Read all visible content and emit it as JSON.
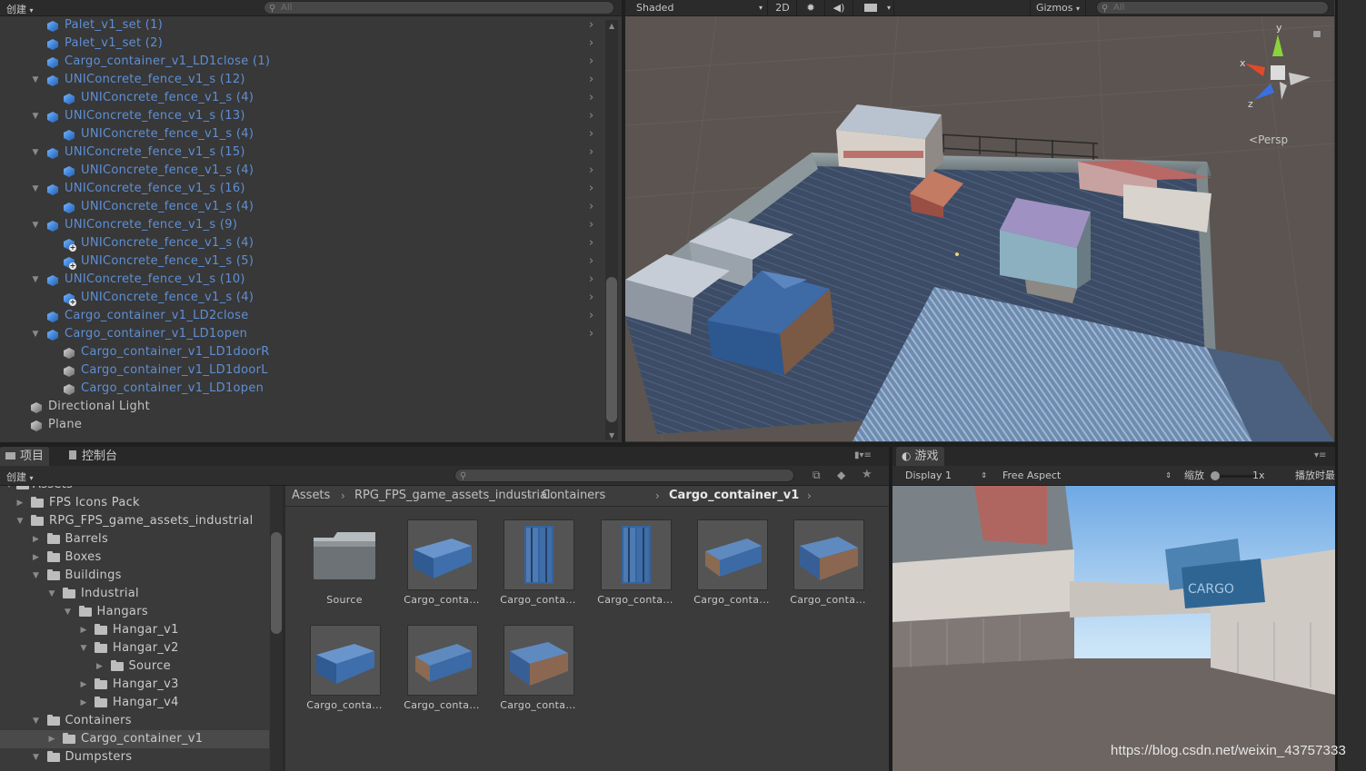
{
  "hierarchy": {
    "create_label": "创建",
    "search_placeholder": "All",
    "rows": [
      {
        "label": "UNIConcrete_fence_v1_s (4)",
        "color": "blue",
        "indent": 1,
        "fold": "",
        "icon": "prefab"
      },
      {
        "label": "Palet_v1_set (1)",
        "color": "blue",
        "indent": 0,
        "fold": "",
        "icon": "prefab"
      },
      {
        "label": "Palet_v1_set (2)",
        "color": "blue",
        "indent": 0,
        "fold": "",
        "icon": "prefab"
      },
      {
        "label": "Cargo_container_v1_LD1close (1)",
        "color": "blue",
        "indent": 0,
        "fold": "",
        "icon": "prefab"
      },
      {
        "label": "UNIConcrete_fence_v1_s (12)",
        "color": "blue",
        "indent": 0,
        "fold": "open",
        "icon": "prefab"
      },
      {
        "label": "UNIConcrete_fence_v1_s (4)",
        "color": "blue",
        "indent": 1,
        "fold": "",
        "icon": "prefab"
      },
      {
        "label": "UNIConcrete_fence_v1_s (13)",
        "color": "blue",
        "indent": 0,
        "fold": "open",
        "icon": "prefab"
      },
      {
        "label": "UNIConcrete_fence_v1_s (4)",
        "color": "blue",
        "indent": 1,
        "fold": "",
        "icon": "prefab"
      },
      {
        "label": "UNIConcrete_fence_v1_s (15)",
        "color": "blue",
        "indent": 0,
        "fold": "open",
        "icon": "prefab"
      },
      {
        "label": "UNIConcrete_fence_v1_s (4)",
        "color": "blue",
        "indent": 1,
        "fold": "",
        "icon": "prefab"
      },
      {
        "label": "UNIConcrete_fence_v1_s (16)",
        "color": "blue",
        "indent": 0,
        "fold": "open",
        "icon": "prefab"
      },
      {
        "label": "UNIConcrete_fence_v1_s (4)",
        "color": "blue",
        "indent": 1,
        "fold": "",
        "icon": "prefab"
      },
      {
        "label": "UNIConcrete_fence_v1_s (9)",
        "color": "blue",
        "indent": 0,
        "fold": "open",
        "icon": "prefab"
      },
      {
        "label": "UNIConcrete_fence_v1_s (4)",
        "color": "blue",
        "indent": 1,
        "fold": "",
        "icon": "prefab-added"
      },
      {
        "label": "UNIConcrete_fence_v1_s (5)",
        "color": "blue",
        "indent": 1,
        "fold": "",
        "icon": "prefab-added"
      },
      {
        "label": "UNIConcrete_fence_v1_s (10)",
        "color": "blue",
        "indent": 0,
        "fold": "open",
        "icon": "prefab"
      },
      {
        "label": "UNIConcrete_fence_v1_s (4)",
        "color": "blue",
        "indent": 1,
        "fold": "",
        "icon": "prefab-added"
      },
      {
        "label": "Cargo_container_v1_LD2close",
        "color": "blue",
        "indent": 0,
        "fold": "",
        "icon": "prefab"
      },
      {
        "label": "Cargo_container_v1_LD1open",
        "color": "blue",
        "indent": 0,
        "fold": "open",
        "icon": "prefab"
      },
      {
        "label": "Cargo_container_v1_LD1doorR",
        "color": "blue",
        "indent": 1,
        "fold": "",
        "icon": "gameobject"
      },
      {
        "label": "Cargo_container_v1_LD1doorL",
        "color": "blue",
        "indent": 1,
        "fold": "",
        "icon": "gameobject"
      },
      {
        "label": "Cargo_container_v1_LD1open",
        "color": "blue",
        "indent": 1,
        "fold": "",
        "icon": "gameobject"
      },
      {
        "label": "Directional Light",
        "color": "grey",
        "indent": -1,
        "fold": "",
        "icon": "gameobject"
      },
      {
        "label": "Plane",
        "color": "grey",
        "indent": -1,
        "fold": "",
        "icon": "gameobject"
      }
    ]
  },
  "scene": {
    "shading_mode": "Shaded",
    "btn_2d": "2D",
    "gizmos_label": "Gizmos",
    "search_placeholder": "All",
    "persp_label": "Persp",
    "axis_x": "x",
    "axis_y": "y",
    "axis_z": "z"
  },
  "project": {
    "tab_project": "项目",
    "tab_console": "控制台",
    "create_label": "创建",
    "tree_top_label": "Assets",
    "tree": [
      {
        "label": "FPS Icons Pack",
        "indent": 0,
        "fold": "closed"
      },
      {
        "label": "RPG_FPS_game_assets_industrial",
        "indent": 0,
        "fold": "open"
      },
      {
        "label": "Barrels",
        "indent": 1,
        "fold": "closed"
      },
      {
        "label": "Boxes",
        "indent": 1,
        "fold": "closed"
      },
      {
        "label": "Buildings",
        "indent": 1,
        "fold": "open"
      },
      {
        "label": "Industrial",
        "indent": 2,
        "fold": "open"
      },
      {
        "label": "Hangars",
        "indent": 3,
        "fold": "open"
      },
      {
        "label": "Hangar_v1",
        "indent": 4,
        "fold": "closed"
      },
      {
        "label": "Hangar_v2",
        "indent": 4,
        "fold": "open"
      },
      {
        "label": "Source",
        "indent": 5,
        "fold": "closed"
      },
      {
        "label": "Hangar_v3",
        "indent": 4,
        "fold": "closed"
      },
      {
        "label": "Hangar_v4",
        "indent": 4,
        "fold": "closed"
      },
      {
        "label": "Containers",
        "indent": 1,
        "fold": "open"
      },
      {
        "label": "Cargo_container_v1",
        "indent": 2,
        "fold": "closed",
        "selected": true
      },
      {
        "label": "Dumpsters",
        "indent": 1,
        "fold": "open"
      }
    ],
    "breadcrumb": [
      "Assets",
      "RPG_FPS_game_assets_industrial",
      "Containers",
      "Cargo_container_v1"
    ],
    "assets": [
      {
        "name": "Source",
        "kind": "folder"
      },
      {
        "name": "Cargo_conta...",
        "kind": "container-a"
      },
      {
        "name": "Cargo_conta...",
        "kind": "container-door"
      },
      {
        "name": "Cargo_conta...",
        "kind": "container-door"
      },
      {
        "name": "Cargo_conta...",
        "kind": "container-open"
      },
      {
        "name": "Cargo_conta...",
        "kind": "container-open-r"
      },
      {
        "name": "Cargo_conta...",
        "kind": "container-a"
      },
      {
        "name": "Cargo_conta...",
        "kind": "container-open"
      },
      {
        "name": "Cargo_conta...",
        "kind": "container-open-r"
      }
    ]
  },
  "game": {
    "tab_label": "游戏",
    "display": "Display 1",
    "aspect": "Free Aspect",
    "scale_label": "缩放",
    "scale_value": "1x",
    "maximize_label": "播放时最"
  },
  "watermark": "https://blog.csdn.net/weixin_43757333",
  "colors": {
    "prefab_blue": "#5d8fd6",
    "selection": "#4a4a4a",
    "panel_bg": "#383838"
  }
}
